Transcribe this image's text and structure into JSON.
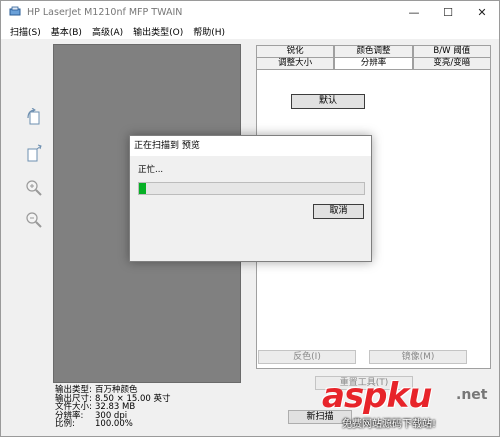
{
  "window": {
    "title": "HP LaserJet M1210nf MFP TWAIN",
    "minimize_glyph": "—",
    "maximize_glyph": "☐",
    "close_glyph": "✕"
  },
  "menu": {
    "items": [
      {
        "label": "扫描(S)"
      },
      {
        "label": "基本(B)"
      },
      {
        "label": "高级(A)"
      },
      {
        "label": "输出类型(O)"
      },
      {
        "label": "帮助(H)"
      }
    ]
  },
  "toolbar": {
    "icons": [
      "rotate-page-icon",
      "flip-page-icon",
      "zoom-in-icon",
      "zoom-out-icon"
    ]
  },
  "tabs": {
    "row1": [
      {
        "label": "锐化"
      },
      {
        "label": "颜色调整"
      },
      {
        "label": "B/W 阈值"
      }
    ],
    "row2": [
      {
        "label": "调整大小"
      },
      {
        "label": "分辨率",
        "active": true
      },
      {
        "label": "变亮/变暗"
      }
    ]
  },
  "resolution": {
    "default_label": "默认",
    "dpi_value": "300",
    "dpi_unit": "dpi"
  },
  "bottom_buttons": {
    "invert_label": "反色(I)",
    "mirror_label": "镜像(M)",
    "reset_label": "重置工具(T)",
    "new_scan_label": "新扫描"
  },
  "info": [
    {
      "label": "输出类型:",
      "value": "百万种颜色"
    },
    {
      "label": "输出尺寸:",
      "value": "8.50 × 15.00 英寸"
    },
    {
      "label": "文件大小:",
      "value": "32.83 MB"
    },
    {
      "label": "分辨率:",
      "value": "300 dpi"
    },
    {
      "label": "比例:",
      "value": "100.00%"
    }
  ],
  "dialog": {
    "title": "正在扫描到 预览",
    "status": "正忙...",
    "progress": 0.03,
    "cancel_label": "取消"
  },
  "watermark": {
    "main": "aspku",
    "suffix": ".net",
    "sub": "免费网站源码下载站!"
  },
  "colors": {
    "preview_gray": "#808080",
    "progress_green": "#06b025",
    "watermark_red": "#e7242a"
  }
}
